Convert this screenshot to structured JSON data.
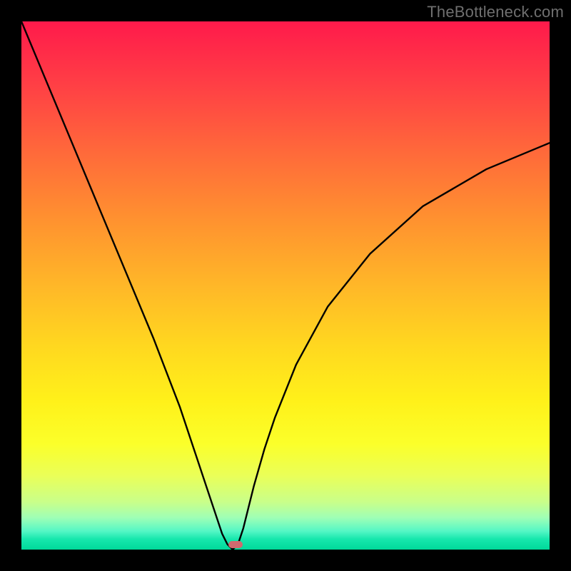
{
  "watermark": "TheBottleneck.com",
  "chart_data": {
    "type": "line",
    "title": "",
    "xlabel": "",
    "ylabel": "",
    "xlim": [
      0,
      100
    ],
    "ylim": [
      0,
      100
    ],
    "grid": false,
    "legend": false,
    "background": "rainbow-vertical-gradient",
    "series": [
      {
        "name": "bottleneck-curve",
        "color": "#000000",
        "x": [
          0,
          5,
          10,
          15,
          20,
          25,
          30,
          33,
          35,
          37,
          38,
          39,
          40,
          41,
          42,
          43,
          44,
          46,
          48,
          52,
          58,
          66,
          76,
          88,
          100
        ],
        "y": [
          100,
          88,
          76,
          64,
          52,
          40,
          27,
          18,
          12,
          6,
          3,
          1,
          0,
          1,
          4,
          8,
          12,
          19,
          25,
          35,
          46,
          56,
          65,
          72,
          77
        ]
      }
    ],
    "minimum_point": {
      "x": 40,
      "y": 0
    },
    "marker": {
      "x_pct": 40.5,
      "y_pct": 99.0,
      "color": "#d06a6f"
    }
  },
  "colors": {
    "frame": "#000000",
    "curve": "#000000",
    "watermark": "#6f6f6f",
    "marker": "#d06a6f"
  }
}
